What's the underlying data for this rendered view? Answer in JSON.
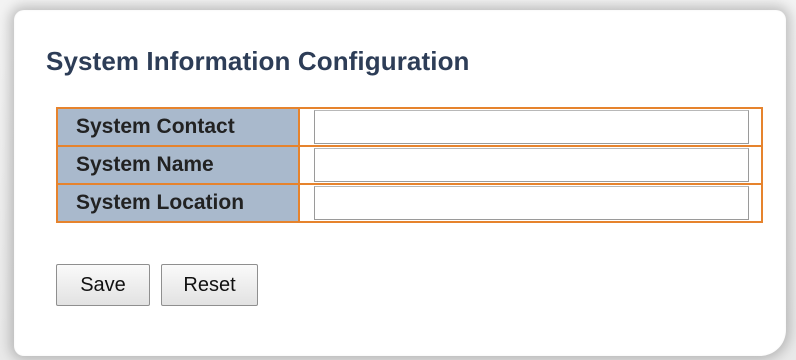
{
  "page": {
    "title": "System Information Configuration"
  },
  "form": {
    "rows": [
      {
        "label": "System Contact",
        "value": ""
      },
      {
        "label": "System Name",
        "value": ""
      },
      {
        "label": "System Location",
        "value": ""
      }
    ]
  },
  "buttons": {
    "save_label": "Save",
    "reset_label": "Reset"
  },
  "colors": {
    "title": "#2d3d57",
    "table_border": "#e6832d",
    "label_background": "#a9b9cc"
  }
}
